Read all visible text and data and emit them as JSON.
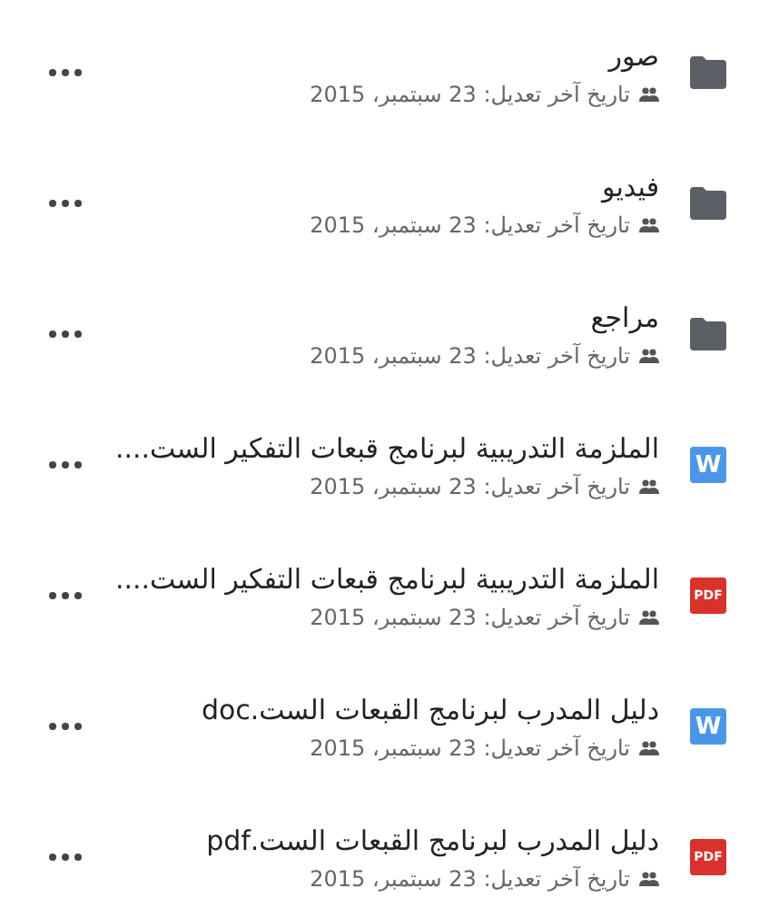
{
  "files": [
    {
      "kind": "folder",
      "name": "صور",
      "modified": "تاريخ آخر تعديل: 23 سبتمبر، 2015"
    },
    {
      "kind": "folder",
      "name": "فيديو",
      "modified": "تاريخ آخر تعديل: 23 سبتمبر، 2015"
    },
    {
      "kind": "folder",
      "name": "مراجع",
      "modified": "تاريخ آخر تعديل: 23 سبتمبر، 2015"
    },
    {
      "kind": "word",
      "name": "الملزمة التدريبية لبرنامج قبعات التفكير الست....",
      "modified": "تاريخ آخر تعديل: 23 سبتمبر، 2015",
      "badge": "W"
    },
    {
      "kind": "pdf",
      "name": "الملزمة التدريبية لبرنامج قبعات التفكير الست....",
      "modified": "تاريخ آخر تعديل: 23 سبتمبر، 2015",
      "badge": "PDF"
    },
    {
      "kind": "word",
      "name": "دليل المدرب لبرنامج القبعات الست.doc",
      "modified": "تاريخ آخر تعديل: 23 سبتمبر، 2015",
      "badge": "W"
    },
    {
      "kind": "pdf",
      "name": "دليل المدرب لبرنامج القبعات الست.pdf",
      "modified": "تاريخ آخر تعديل: 23 سبتمبر، 2015",
      "badge": "PDF"
    }
  ]
}
